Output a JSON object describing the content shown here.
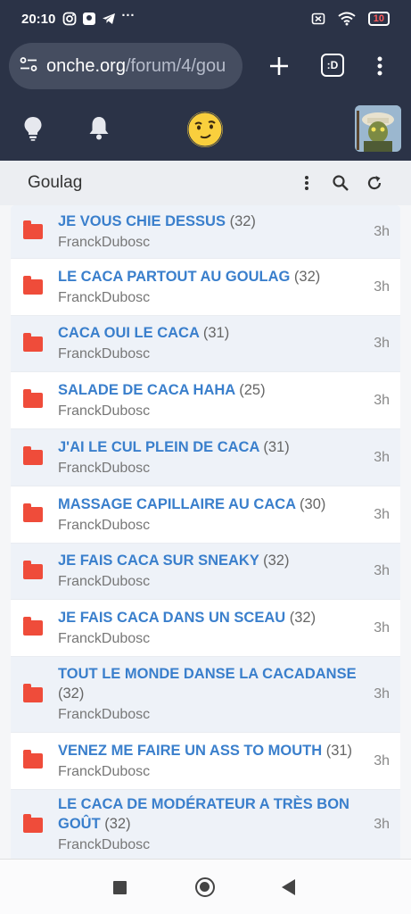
{
  "status": {
    "time": "20:10",
    "battery": "10"
  },
  "browser": {
    "url_host": "onche.org",
    "url_path": "/forum/4/gou",
    "tabs_label": ":D"
  },
  "forum": {
    "title": "Goulag"
  },
  "topics": [
    {
      "title": "JE VOUS CHIE DESSUS",
      "count": "(32)",
      "author": "FranckDubosc",
      "time": "3h"
    },
    {
      "title": "LE CACA PARTOUT AU GOULAG",
      "count": "(32)",
      "author": "FranckDubosc",
      "time": "3h"
    },
    {
      "title": "CACA OUI LE CACA",
      "count": "(31)",
      "author": "FranckDubosc",
      "time": "3h"
    },
    {
      "title": "SALADE DE CACA HAHA",
      "count": "(25)",
      "author": "FranckDubosc",
      "time": "3h"
    },
    {
      "title": "J'AI LE CUL PLEIN DE CACA",
      "count": "(31)",
      "author": "FranckDubosc",
      "time": "3h"
    },
    {
      "title": "MASSAGE CAPILLAIRE AU CACA",
      "count": "(30)",
      "author": "FranckDubosc",
      "time": "3h"
    },
    {
      "title": "JE FAIS CACA SUR SNEAKY",
      "count": "(32)",
      "author": "FranckDubosc",
      "time": "3h"
    },
    {
      "title": "JE FAIS CACA DANS UN SCEAU",
      "count": "(32)",
      "author": "FranckDubosc",
      "time": "3h"
    },
    {
      "title": "TOUT LE MONDE DANSE LA CACADANSE",
      "count": "(32)",
      "author": "FranckDubosc",
      "time": "3h"
    },
    {
      "title": "VENEZ ME FAIRE UN ASS TO MOUTH",
      "count": "(31)",
      "author": "FranckDubosc",
      "time": "3h"
    },
    {
      "title": "LE CACA DE MODÉRATEUR A TRÈS BON GOÛT",
      "count": "(32)",
      "author": "FranckDubosc",
      "time": "3h"
    }
  ],
  "colors": {
    "header_bg": "#2b3347",
    "link": "#3a7fcc",
    "folder": "#ef4c3a",
    "alt_row": "#eef2f8"
  }
}
